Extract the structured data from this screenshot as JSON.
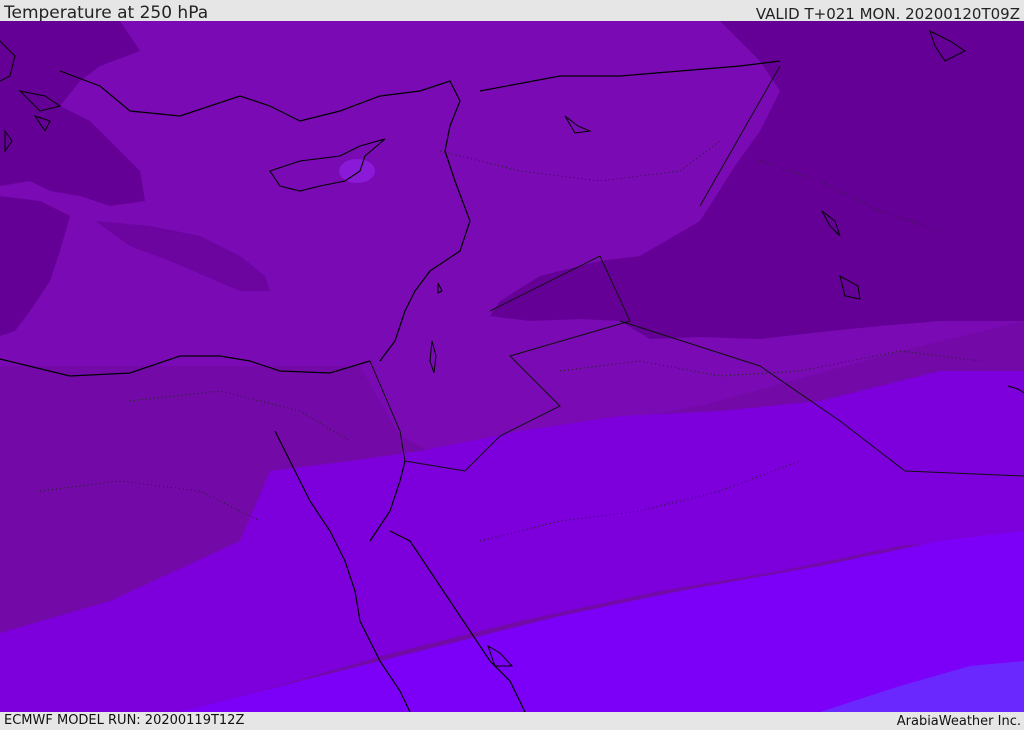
{
  "header": {
    "title": "Temperature at 250 hPa",
    "valid_time": "VALID T+021 MON. 20200120T09Z"
  },
  "footer": {
    "model_run": "ECMWF MODEL RUN: 20200119T12Z",
    "credit": "ArabiaWeather Inc."
  },
  "map": {
    "field": "temperature",
    "level": "250 hPa",
    "region": "Eastern Mediterranean, Levant, Egypt, Arabia",
    "colors": {
      "darkest": "#650096",
      "dark": "#730aa8",
      "medium": "#7a0ab4",
      "violet": "#7d00dc",
      "bright": "#7c00f8",
      "blue_violet": "#6a28ff",
      "coastline": "#000000",
      "land_border": "#1a1a1a"
    }
  }
}
